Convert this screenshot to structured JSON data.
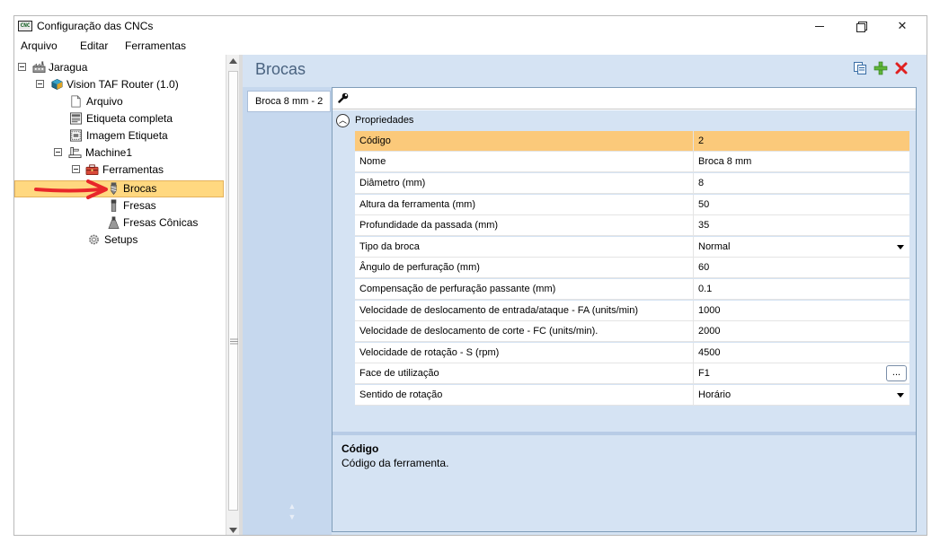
{
  "window": {
    "title": "Configuração das CNCs",
    "app_icon_text": "CNC",
    "controls": {
      "minimize": "─",
      "maximize": "❐",
      "close": "✕"
    }
  },
  "menu": [
    "Arquivo",
    "Editar",
    "Ferramentas"
  ],
  "tree": [
    {
      "label": "Jaragua",
      "icon": "factory-icon"
    },
    {
      "label": "Vision TAF Router (1.0)",
      "icon": "cube-icon"
    },
    {
      "label": "Arquivo",
      "icon": "file-icon"
    },
    {
      "label": "Etiqueta completa",
      "icon": "label-icon"
    },
    {
      "label": "Imagem Etiqueta",
      "icon": "image-label-icon"
    },
    {
      "label": "Machine1",
      "icon": "machine-icon"
    },
    {
      "label": "Ferramentas",
      "icon": "toolbox-icon"
    },
    {
      "label": "Brocas",
      "icon": "drill-icon"
    },
    {
      "label": "Fresas",
      "icon": "end-mill-icon"
    },
    {
      "label": "Fresas Cônicas",
      "icon": "conical-mill-icon"
    },
    {
      "label": "Setups",
      "icon": "gear-icon"
    }
  ],
  "selected_tree_item": "Brocas",
  "header": {
    "title": "Brocas",
    "actions": {
      "copy": "copy-icon",
      "add": "add-icon",
      "delete": "delete-icon"
    }
  },
  "tabs": [
    "Broca 8 mm - 2"
  ],
  "property_grid": {
    "category": "Propriedades",
    "properties": [
      {
        "name": "Código",
        "value": "2"
      },
      {
        "name": "Nome",
        "value": "Broca 8 mm"
      },
      {
        "name": "Diâmetro (mm)",
        "value": "8"
      },
      {
        "name": "Altura da ferramenta (mm)",
        "value": "50"
      },
      {
        "name": "Profundidade da passada (mm)",
        "value": "35"
      },
      {
        "name": "Tipo da broca",
        "value": "Normal"
      },
      {
        "name": "Ângulo de perfuração (mm)",
        "value": "60"
      },
      {
        "name": "Compensação de perfuração passante (mm)",
        "value": "0.1"
      },
      {
        "name": "Velocidade de deslocamento de entrada/ataque - FA (units/min)",
        "value": "1000"
      },
      {
        "name": "Velocidade de deslocamento de corte - FC (units/min).",
        "value": "2000"
      },
      {
        "name": "Velocidade de rotação - S (rpm)",
        "value": "4500"
      },
      {
        "name": "Face de utilização",
        "value": "F1"
      },
      {
        "name": "Sentido de rotação",
        "value": "Horário"
      }
    ],
    "ellipsis_label": "...",
    "help": {
      "title": "Código",
      "text": "Código da ferramenta."
    }
  },
  "colors": {
    "selection": "#ffd880",
    "selected_row": "#fbc97a",
    "panel_bg": "#d5e3f3",
    "header_text": "#4a6380",
    "add": "#5fb43a",
    "delete": "#e02020",
    "arrow": "#e8262a"
  }
}
